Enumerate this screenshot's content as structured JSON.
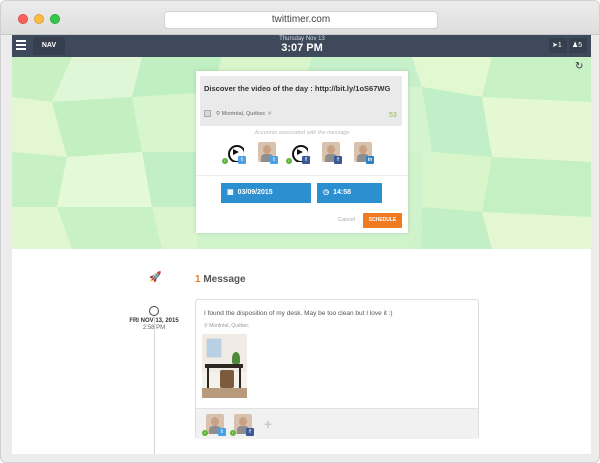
{
  "browser": {
    "url": "twittimer.com"
  },
  "nav": {
    "menu_label": "NAV",
    "date": "Thursday Nov 13",
    "time": "3:07 PM",
    "badge_send": "1",
    "badge_users": "5"
  },
  "composer": {
    "tweet_text": "Discover the video of the day : http://bit.ly/1oS67WG",
    "location": "Montréal, Québec",
    "char_count": "53",
    "accounts_label": "Accounts associated with the message",
    "accounts": [
      {
        "icon": "play-logo",
        "network": "twitter",
        "checked": true
      },
      {
        "icon": "user-photo",
        "network": "twitter",
        "checked": false
      },
      {
        "icon": "play-logo",
        "network": "facebook",
        "checked": true
      },
      {
        "icon": "user-photo",
        "network": "facebook",
        "checked": false
      },
      {
        "icon": "user-photo",
        "network": "linkedin",
        "checked": false
      }
    ],
    "date_value": "03/09/2015",
    "time_value": "14:58",
    "cancel_label": "Cancel",
    "schedule_label": "SCHEDULE"
  },
  "feed": {
    "message_count": "1",
    "message_label": "Message",
    "post": {
      "date": "FRI NOV 13, 2015",
      "time": "2:58 PM",
      "text": "I found the disposition of my desk. May be too clean but I love it :)",
      "location": "Montréal, Québec"
    }
  },
  "colors": {
    "navbar": "#3e4a5b",
    "accent_orange": "#f07a22",
    "accent_blue": "#2b8fd0",
    "hero_green": "#d4f5cf"
  }
}
